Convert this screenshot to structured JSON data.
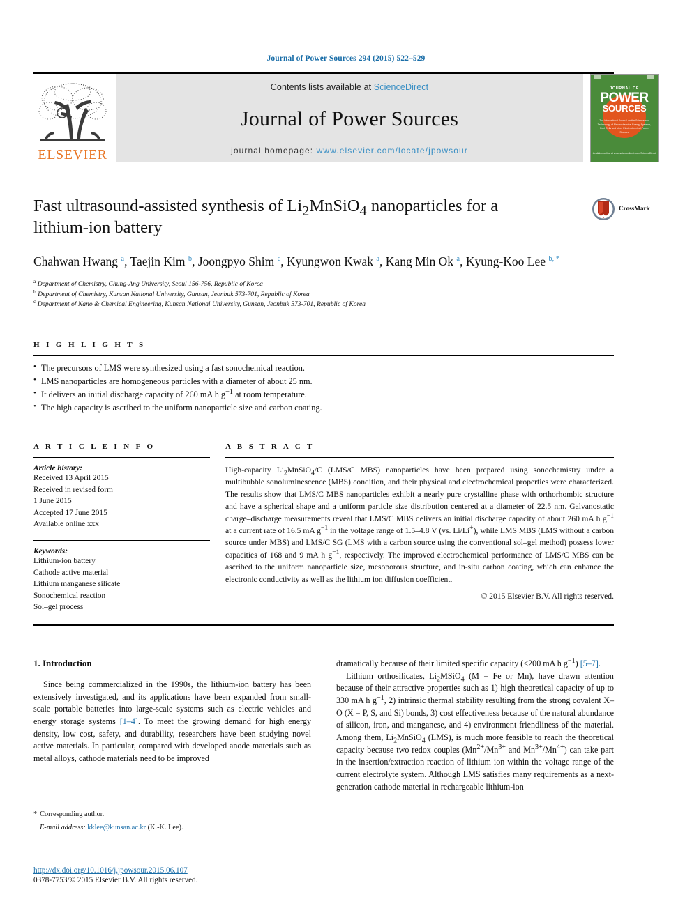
{
  "running_head": "Journal of Power Sources 294 (2015) 522–529",
  "masthead": {
    "contents_prefix": "Contents lists available at ",
    "sciencedirect": "ScienceDirect",
    "journal_name": "Journal of Power Sources",
    "homepage_prefix": "journal homepage: ",
    "homepage_url": "www.elsevier.com/locate/jpowsour",
    "publisher_wordmark": "ELSEVIER",
    "cover": {
      "journal_of": "JOURNAL OF",
      "power": "POWER",
      "sources": "SOURCES",
      "blurb": "The International Journal on the Science and Technology of Electrochemical Energy Systems, Fuel Cells and other Electrochemical Power Sources",
      "footer": "Available online at www.sciencedirect.com ScienceDirect"
    },
    "accent_blue": "#3a8fc4",
    "band_gray": "#e4e4e4",
    "elsevier_orange": "#e87422",
    "cover_green": "#4a8b3a"
  },
  "article": {
    "title": "Fast ultrasound-assisted synthesis of Li2MnSiO4 nanoparticles for a lithium-ion battery",
    "crossmark_label": "CrossMark",
    "authors": [
      {
        "name": "Chahwan Hwang",
        "marks": "a"
      },
      {
        "name": "Taejin Kim",
        "marks": "b"
      },
      {
        "name": "Joongpyo Shim",
        "marks": "c"
      },
      {
        "name": "Kyungwon Kwak",
        "marks": "a"
      },
      {
        "name": "Kang Min Ok",
        "marks": "a"
      },
      {
        "name": "Kyung-Koo Lee",
        "marks": "b, *"
      }
    ],
    "affiliations": [
      {
        "mark": "a",
        "text": "Department of Chemistry, Chung-Ang University, Seoul 156-756, Republic of Korea"
      },
      {
        "mark": "b",
        "text": "Department of Chemistry, Kunsan National University, Gunsan, Jeonbuk 573-701, Republic of Korea"
      },
      {
        "mark": "c",
        "text": "Department of Nano & Chemical Engineering, Kunsan National University, Gunsan, Jeonbuk 573-701, Republic of Korea"
      }
    ]
  },
  "highlights": {
    "heading": "H I G H L I G H T S",
    "items": [
      "The precursors of LMS were synthesized using a fast sonochemical reaction.",
      "LMS nanoparticles are homogeneous particles with a diameter of about 25 nm.",
      "It delivers an initial discharge capacity of 260 mA h g−1 at room temperature.",
      "The high capacity is ascribed to the uniform nanoparticle size and carbon coating."
    ]
  },
  "article_info": {
    "heading": "A R T I C L E   I N F O",
    "history_label": "Article history:",
    "history": [
      "Received 13 April 2015",
      "Received in revised form",
      "1 June 2015",
      "Accepted 17 June 2015",
      "Available online xxx"
    ],
    "keywords_label": "Keywords:",
    "keywords": [
      "Lithium-ion battery",
      "Cathode active material",
      "Lithium manganese silicate",
      "Sonochemical reaction",
      "Sol–gel process"
    ]
  },
  "abstract": {
    "heading": "A B S T R A C T",
    "text": "High-capacity Li2MnSiO4/C (LMS/C MBS) nanoparticles have been prepared using sonochemistry under a multibubble sonoluminescence (MBS) condition, and their physical and electrochemical properties were characterized. The results show that LMS/C MBS nanoparticles exhibit a nearly pure crystalline phase with orthorhombic structure and have a spherical shape and a uniform particle size distribution centered at a diameter of 22.5 nm. Galvanostatic charge–discharge measurements reveal that LMS/C MBS delivers an initial discharge capacity of about 260 mA h g−1 at a current rate of 16.5 mA g−1 in the voltage range of 1.5–4.8 V (vs. Li/Li+), while LMS MBS (LMS without a carbon source under MBS) and LMS/C SG (LMS with a carbon source using the conventional sol–gel method) possess lower capacities of 168 and 9 mA h g−1, respectively. The improved electrochemical performance of LMS/C MBS can be ascribed to the uniform nanoparticle size, mesoporous structure, and in-situ carbon coating, which can enhance the electronic conductivity as well as the lithium ion diffusion coefficient.",
    "copyright": "© 2015 Elsevier B.V. All rights reserved."
  },
  "introduction": {
    "heading": "1. Introduction",
    "left_paragraph": "Since being commercialized in the 1990s, the lithium-ion battery has been extensively investigated, and its applications have been expanded from small-scale portable batteries into large-scale systems such as electric vehicles and energy storage systems [1–4]. To meet the growing demand for high energy density, low cost, safety, and durability, researchers have been studying novel active materials. In particular, compared with developed anode materials such as metal alloys, cathode materials need to be improved",
    "right_paragraph_1": "dramatically because of their limited specific capacity (<200 mA h g−1) [5–7].",
    "right_paragraph_2": "Lithium orthosilicates, Li2MSiO4 (M = Fe or Mn), have drawn attention because of their attractive properties such as 1) high theoretical capacity of up to 330 mA h g−1, 2) intrinsic thermal stability resulting from the strong covalent X–O (X = P, S, and Si) bonds, 3) cost effectiveness because of the natural abundance of silicon, iron, and manganese, and 4) environment friendliness of the material. Among them, Li2MnSiO4 (LMS), is much more feasible to reach the theoretical capacity because two redox couples (Mn2+/Mn3+ and Mn3+/Mn4+) can take part in the insertion/extraction reaction of lithium ion within the voltage range of the current electrolyte system. Although LMS satisfies many requirements as a next-generation cathode material in rechargeable lithium-ion"
  },
  "footer": {
    "corresponding_star": "*",
    "corresponding_label": "Corresponding author.",
    "email_label": "E-mail address:",
    "email": "kklee@kunsan.ac.kr",
    "email_suffix": "(K.-K. Lee).",
    "doi": "http://dx.doi.org/10.1016/j.jpowsour.2015.06.107",
    "issn_line": "0378-7753/© 2015 Elsevier B.V. All rights reserved."
  }
}
